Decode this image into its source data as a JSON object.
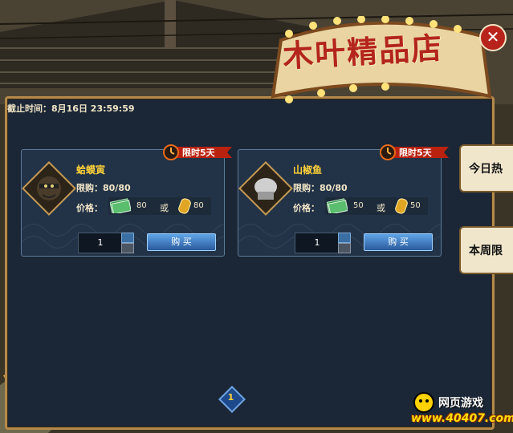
{
  "window": {
    "title": "木叶精品店",
    "close_label": "✕",
    "deadline": "截止时间：8月16日 23:59:59"
  },
  "items": [
    {
      "name": "蛤蟆寅",
      "limit": "限购：80/80",
      "price_label": "价格：",
      "cash_price": "80",
      "or_label": "或",
      "gold_price": "80",
      "badge": "限时5天",
      "quantity": "1",
      "buy_label": "购 买",
      "thumb_icon": "ninja-portrait-icon"
    },
    {
      "name": "山椒鱼",
      "limit": "限购：80/80",
      "price_label": "价格：",
      "cash_price": "50",
      "or_label": "或",
      "gold_price": "50",
      "badge": "限时5天",
      "quantity": "1",
      "buy_label": "购 买",
      "thumb_icon": "hidden-portrait-icon"
    }
  ],
  "side_tabs": [
    {
      "label": "今日热"
    },
    {
      "label": "本周限"
    }
  ],
  "pager": {
    "current_page": "1"
  },
  "brand": {
    "top": "网页游戏",
    "bottom": "www.40407.com"
  },
  "colors": {
    "panel_bg": "#1b2736",
    "card_bg": "#233347",
    "frame": "#b58a4a",
    "title_red": "#b3251c",
    "name_yellow": "#ffd23a",
    "buy_button": "#2a5a9c"
  }
}
